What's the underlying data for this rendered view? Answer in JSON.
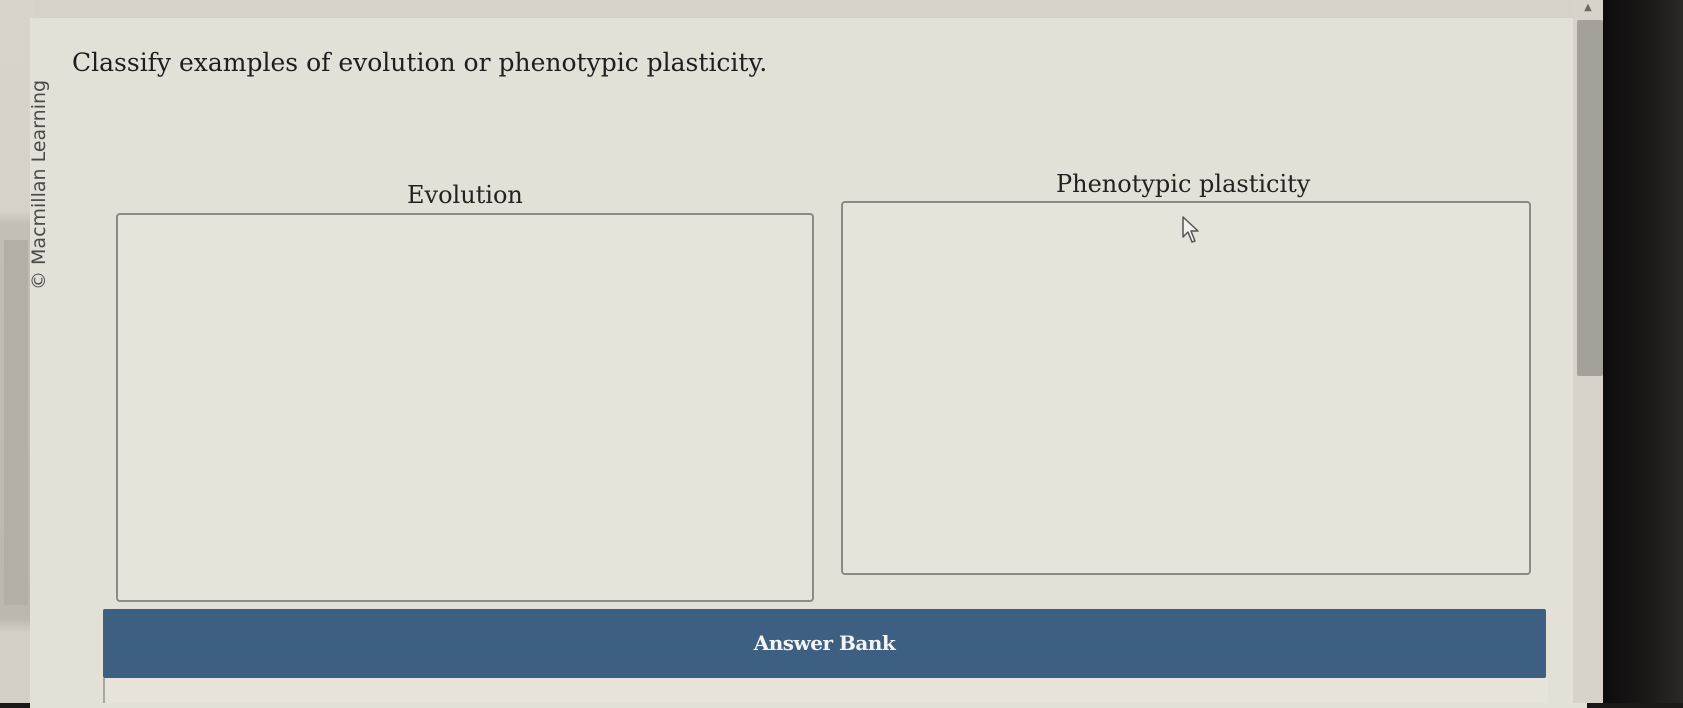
{
  "copyright": "© Macmillan Learning",
  "question": "Classify examples of evolution or phenotypic plasticity.",
  "categories": [
    {
      "label": "Evolution"
    },
    {
      "label": "Phenotypic plasticity"
    }
  ],
  "answer_bank": {
    "label": "Answer Bank"
  },
  "icons": {
    "cursor": "mouse-pointer-icon",
    "scroll_up": "chevron-up-icon"
  },
  "colors": {
    "answer_bank_bar": "#3d5f82",
    "page_background": "#e3e0d7"
  }
}
